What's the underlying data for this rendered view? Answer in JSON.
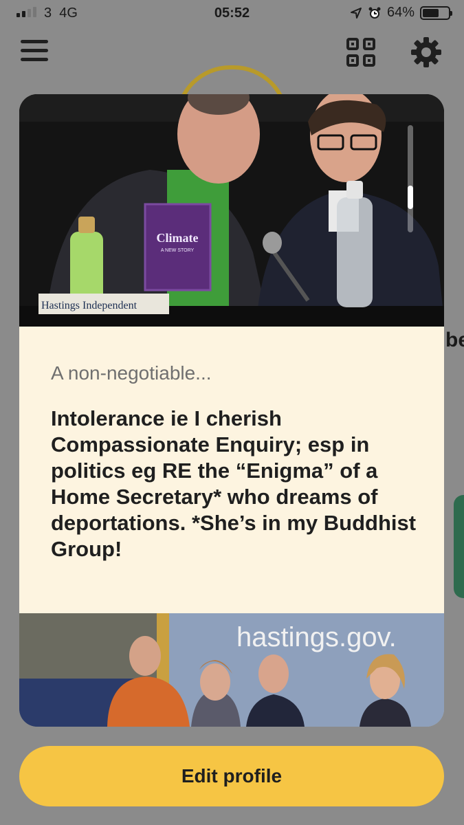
{
  "status_bar": {
    "carrier": "3",
    "network": "4G",
    "time": "05:52",
    "battery": "64%",
    "battery_level": 0.64
  },
  "header": {
    "menu_icon": "hamburger-menu-icon",
    "qr_icon": "qr-code-icon",
    "settings_icon": "gear-icon"
  },
  "card": {
    "photo_top": {
      "book_title": "Climate",
      "book_subtitle": "A NEW STORY",
      "banner": "Hastings Independent"
    },
    "prompt": {
      "label": "A non-negotiable...",
      "answer": "Intolerance ie I cherish Compassionate Enquiry; esp in politics eg RE the “Enigma” of a Home Secretary* who dreams of deportations. *She’s in my Buddhist Group!"
    },
    "photo_bottom": {
      "sign_text": "hastings.gov."
    }
  },
  "background": {
    "partial_text": "be"
  },
  "actions": {
    "edit_profile_label": "Edit profile"
  },
  "colors": {
    "accent": "#f6c544",
    "card_bg": "#fdf4e0",
    "overlay": "#8b8b8b"
  }
}
